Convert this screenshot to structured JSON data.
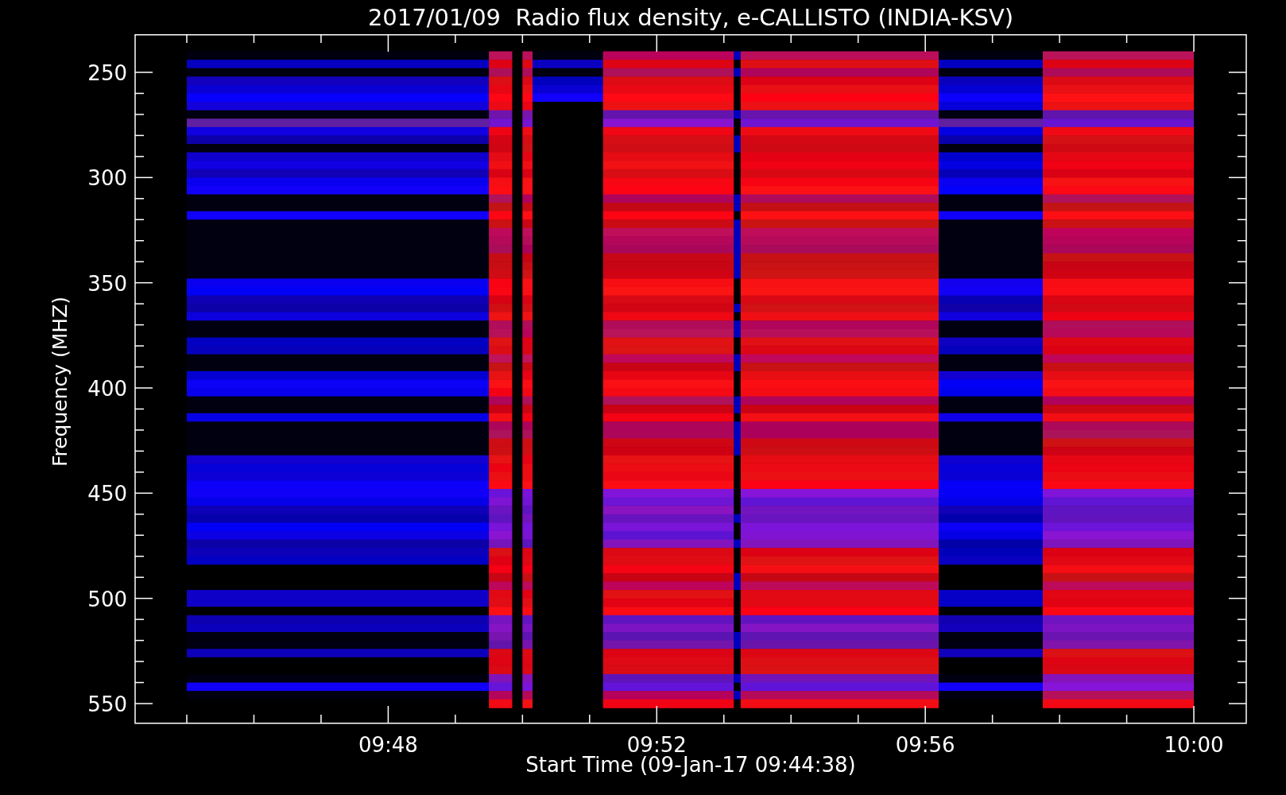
{
  "title": "2017/01/09  Radio flux density, e-CALLISTO (INDIA-KSV)",
  "y_axis": {
    "label": "Frequency (MHZ)",
    "ticks": [
      "250",
      "300",
      "350",
      "400",
      "450",
      "500",
      "550"
    ]
  },
  "x_axis": {
    "label": "Start Time (09-Jan-17 09:44:38)",
    "ticks": [
      "09:48",
      "09:52",
      "09:56",
      "10:00"
    ]
  }
}
